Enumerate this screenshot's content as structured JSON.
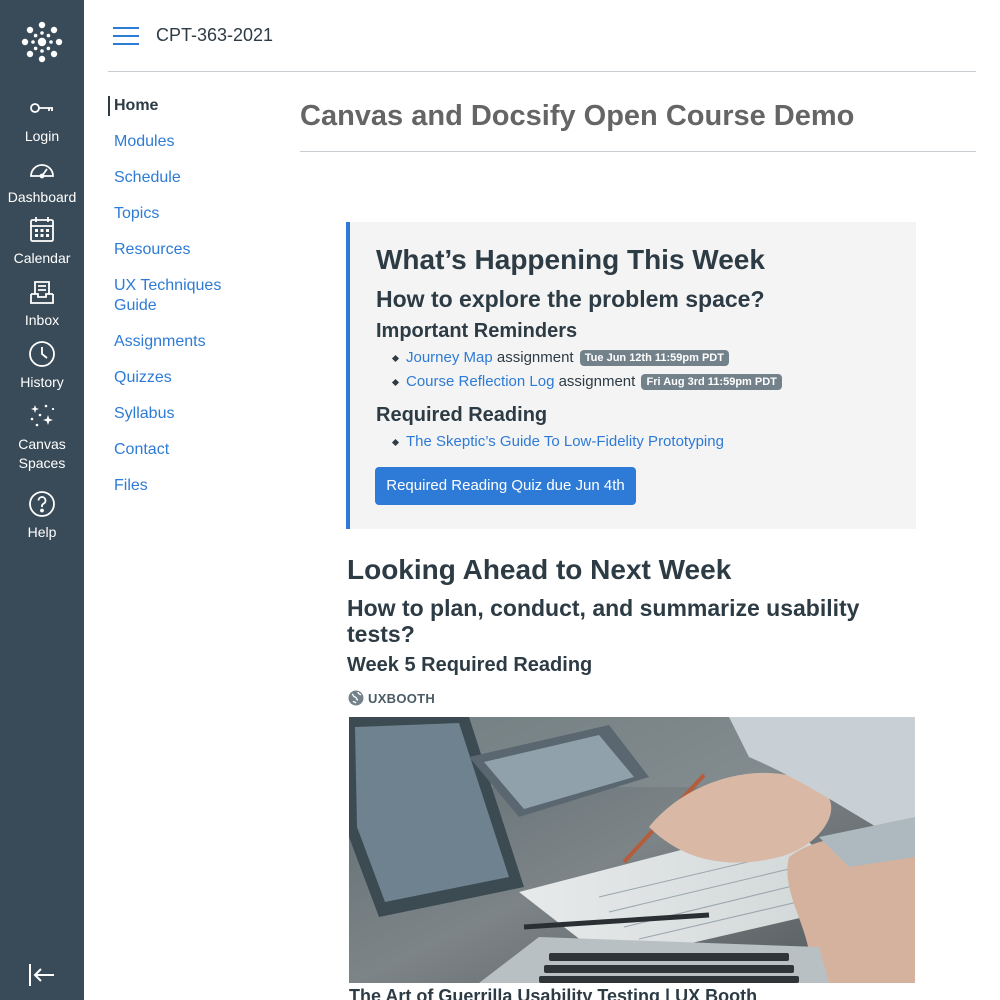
{
  "global_nav": {
    "items": [
      {
        "label": "Login",
        "icon": "key-icon"
      },
      {
        "label": "Dashboard",
        "icon": "dashboard-icon"
      },
      {
        "label": "Calendar",
        "icon": "calendar-icon"
      },
      {
        "label": "Inbox",
        "icon": "inbox-icon"
      },
      {
        "label": "History",
        "icon": "clock-icon"
      },
      {
        "label": "Canvas Spaces",
        "icon": "sparkle-icon"
      },
      {
        "label": "Help",
        "icon": "help-icon"
      }
    ],
    "colors": {
      "background": "#394b58",
      "text": "#ffffff"
    }
  },
  "header": {
    "breadcrumb": "CPT-363-2021"
  },
  "course_nav": {
    "items": [
      {
        "label": "Home"
      },
      {
        "label": "Modules"
      },
      {
        "label": "Schedule"
      },
      {
        "label": "Topics"
      },
      {
        "label": "Resources"
      },
      {
        "label": "UX Techniques Guide"
      },
      {
        "label": "Assignments"
      },
      {
        "label": "Quizzes"
      },
      {
        "label": "Syllabus"
      },
      {
        "label": "Contact"
      },
      {
        "label": "Files"
      }
    ]
  },
  "page": {
    "title": "Canvas and Docsify Open Course Demo"
  },
  "this_week": {
    "heading": "What’s Happening This Week",
    "question": "How to explore the problem space?",
    "reminders_heading": "Important Reminders",
    "reminders": [
      {
        "link": "Journey Map",
        "suffix": "assignment",
        "badge": "Tue Jun 12th 11:59pm PDT"
      },
      {
        "link": "Course Reflection Log",
        "suffix": "assignment",
        "badge": "Fri Aug 3rd 11:59pm PDT"
      }
    ],
    "reading_heading": "Required Reading",
    "reading": [
      {
        "link": "The Skeptic’s Guide To Low-Fidelity Prototyping"
      }
    ],
    "quiz_button": "Required Reading Quiz due Jun 4th"
  },
  "next_week": {
    "heading": "Looking Ahead to Next Week",
    "question": "How to plan, conduct, and summarize usability tests?",
    "reading_heading": "Week 5 Required Reading",
    "source": "UXBOOTH",
    "article_title": "The Art of Guerrilla Usability Testing | UX Booth"
  },
  "colors": {
    "accent": "#2d7bd6",
    "badge": "#73818b",
    "highlight_box": "#f4f4f4"
  }
}
